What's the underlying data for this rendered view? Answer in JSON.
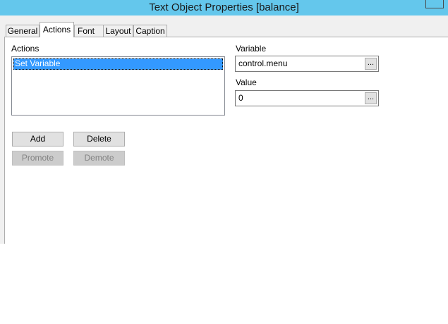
{
  "window": {
    "title": "Text Object Properties [balance]"
  },
  "tabs": [
    {
      "label": "General",
      "active": false
    },
    {
      "label": "Actions",
      "active": true
    },
    {
      "label": "Font",
      "active": false
    },
    {
      "label": "Layout",
      "active": false
    },
    {
      "label": "Caption",
      "active": false
    }
  ],
  "actions": {
    "label": "Actions",
    "items": [
      {
        "label": "Set Variable",
        "selected": true
      }
    ],
    "buttons": {
      "add": "Add",
      "delete": "Delete",
      "promote": "Promote",
      "demote": "Demote"
    }
  },
  "variable": {
    "label": "Variable",
    "value": "control.menu",
    "browse_label": "..."
  },
  "value_field": {
    "label": "Value",
    "value": "0",
    "browse_label": "..."
  },
  "colors": {
    "titlebar": "#64c7ec",
    "selection": "#3399ff",
    "dialog_background": "#f0f0f0"
  }
}
